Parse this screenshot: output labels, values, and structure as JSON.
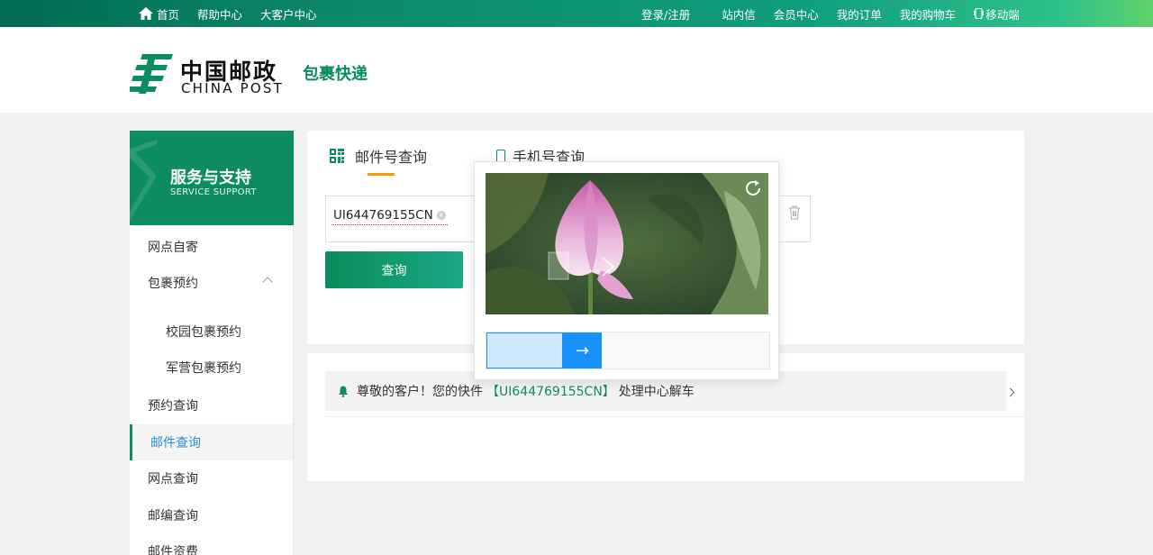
{
  "topbar": {
    "home": "首页",
    "help": "帮助中心",
    "enterprise": "大客户中心",
    "login": "登录/注册",
    "inbox": "站内信",
    "member": "会员中心",
    "orders": "我的订单",
    "cart": "我的购物车",
    "mobile": "移动端"
  },
  "header": {
    "brand_cn": "中国邮政",
    "brand_en": "CHINA POST",
    "product": "包裹快递"
  },
  "sidebar": {
    "title": "服务与支持",
    "subtitle": "SERVICE SUPPORT",
    "items": [
      {
        "label": "网点自寄"
      },
      {
        "label": "包裹预约"
      },
      {
        "label": "校园包裹预约"
      },
      {
        "label": "军营包裹预约"
      },
      {
        "label": "预约查询"
      },
      {
        "label": "邮件查询"
      },
      {
        "label": "网点查询"
      },
      {
        "label": "邮编查询"
      },
      {
        "label": "邮件资费"
      }
    ]
  },
  "main": {
    "tab_mail": "邮件号查询",
    "tab_phone": "手机号查询",
    "tracking_tag": "UI644769155CN",
    "query_button": "查询"
  },
  "notice": {
    "prefix": "尊敬的客户！您的快件",
    "tracking": "【UI644769155CN】",
    "suffix": "处理中心解车"
  },
  "captcha": {
    "slider_arrow": "→",
    "slider_progress": 0.27
  },
  "colors": {
    "brand_green": "#0d8c61",
    "accent_orange": "#f39c12",
    "slider_blue": "#1991fa"
  }
}
